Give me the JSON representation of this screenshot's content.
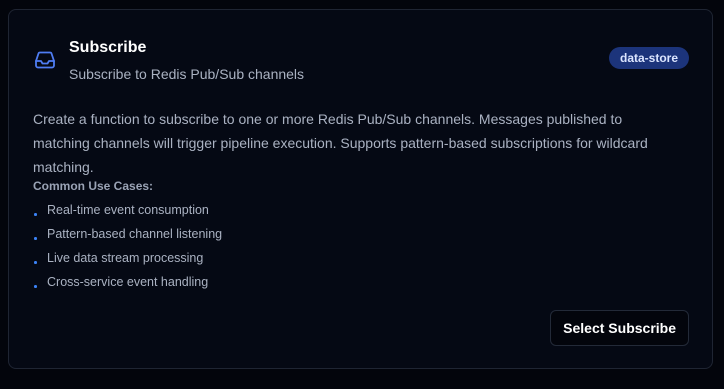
{
  "card": {
    "icon": "inbox-icon",
    "title": "Subscribe",
    "subtitle": "Subscribe to Redis Pub/Sub channels",
    "badge": "data-store",
    "description": "Create a function to subscribe to one or more Redis Pub/Sub channels. Messages published to matching channels will trigger pipeline execution. Supports pattern-based subscriptions for wildcard matching.",
    "use_cases_heading": "Common Use Cases:",
    "use_cases": [
      "Real-time event consumption",
      "Pattern-based channel listening",
      "Live data stream processing",
      "Cross-service event handling"
    ],
    "select_button_label": "Select Subscribe"
  },
  "colors": {
    "page_background": "#03050c",
    "card_background": "#050914",
    "card_border": "#1f2533",
    "accent": "#3b82f6",
    "badge_background": "#1c347b",
    "muted_text": "#aab2c2"
  }
}
